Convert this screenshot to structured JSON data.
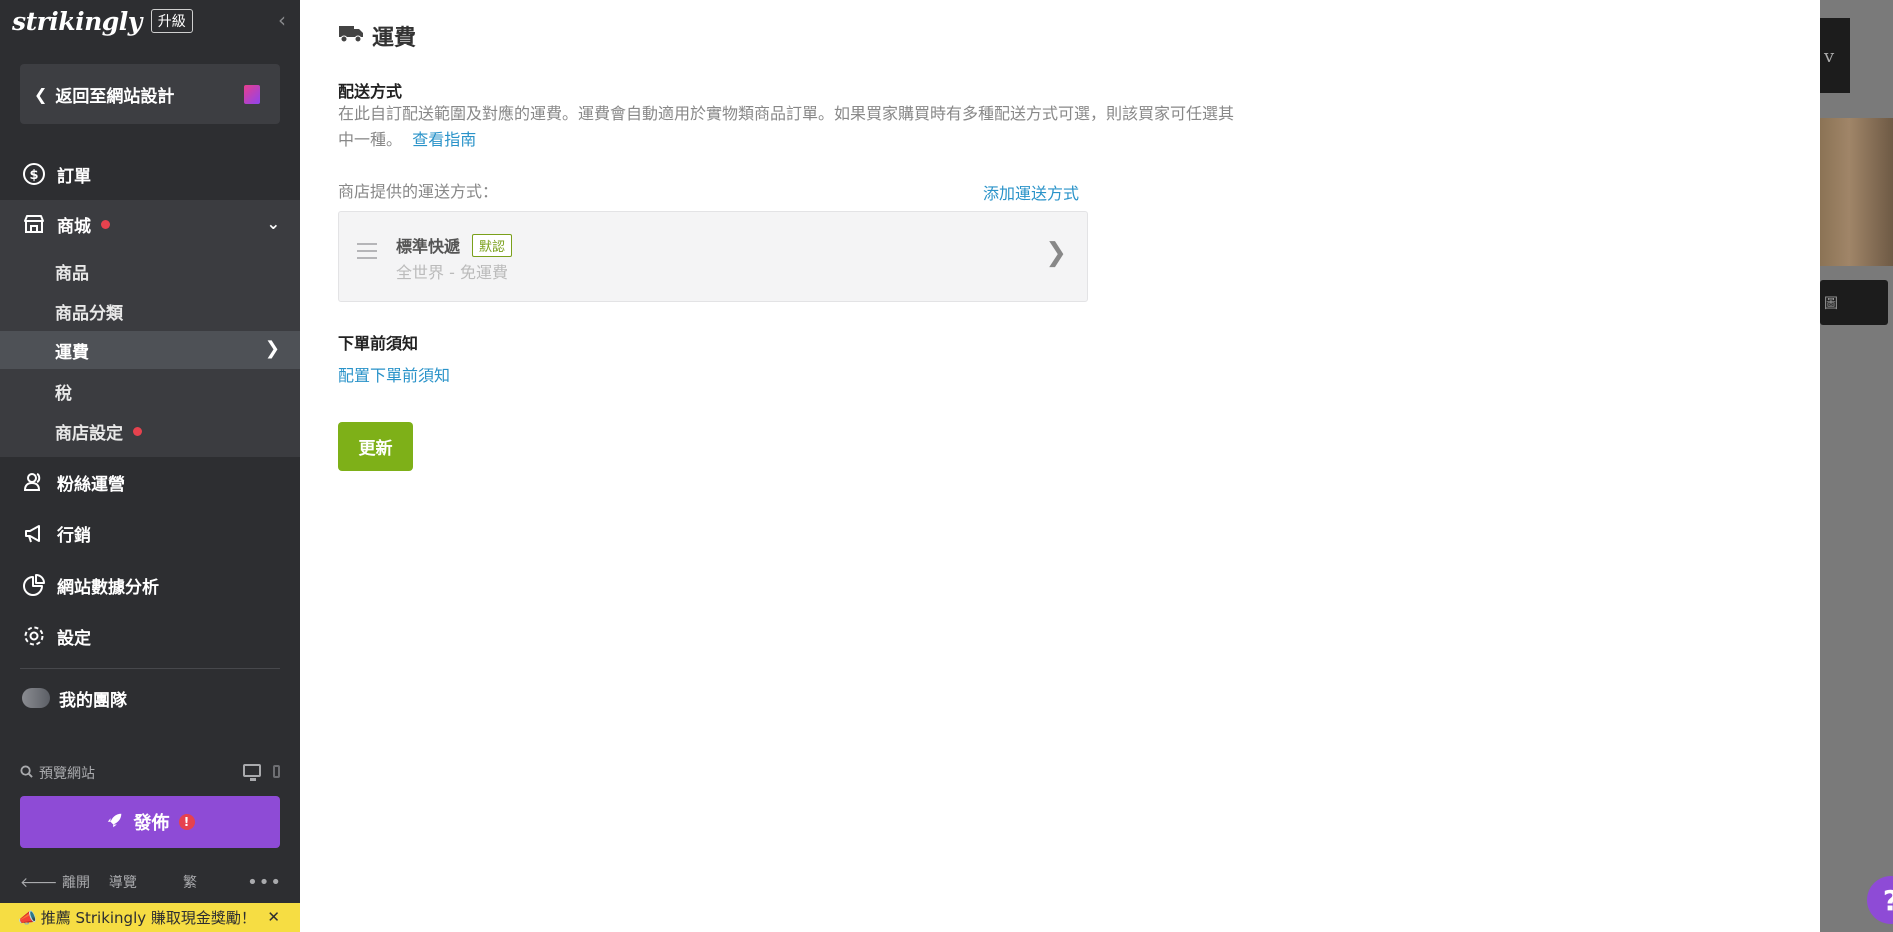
{
  "sidebar": {
    "logo": "strikingly",
    "upgrade": "升級",
    "collapse_icon": "‹",
    "back_to_design": "返回至網站設計",
    "nav": {
      "orders": "訂單",
      "store": "商城",
      "fans": "粉絲運營",
      "marketing": "行銷",
      "analytics": "網站數據分析",
      "settings": "設定",
      "team": "我的團隊"
    },
    "store_sub": {
      "products": "商品",
      "categories": "商品分類",
      "shipping": "運費",
      "tax": "稅",
      "store_settings": "商店設定"
    },
    "preview": "預覽網站",
    "publish": "發佈",
    "publish_alert": "!",
    "footer": {
      "leave": "離開",
      "guide": "導覽",
      "language": "繁",
      "more": "•••"
    },
    "referral": "推薦 Strikingly 賺取現金獎勵！",
    "referral_close": "✕"
  },
  "main": {
    "title": "運費",
    "delivery_title": "配送方式",
    "delivery_desc": "在此自訂配送範圍及對應的運費。運費會自動適用於實物類商品訂單。如果買家購買時有多種配送方式可選，則該買家可任選其中一種。",
    "view_guide": "查看指南",
    "methods_label": "商店提供的運送方式：",
    "add_method": "添加運送方式",
    "method": {
      "name": "標準快遞",
      "badge": "默認",
      "detail": "全世界 - 免運費"
    },
    "notice_title": "下單前須知",
    "configure_notice": "配置下單前須知",
    "update": "更新"
  },
  "background": {
    "help": "?"
  },
  "colors": {
    "sidebar_bg": "#2d2e31",
    "accent_purple": "#8e4bd6",
    "update_green": "#7eb018",
    "link_blue": "#2a93c9",
    "alert_red": "#e6424e",
    "referral_yellow": "#f6dd43"
  }
}
